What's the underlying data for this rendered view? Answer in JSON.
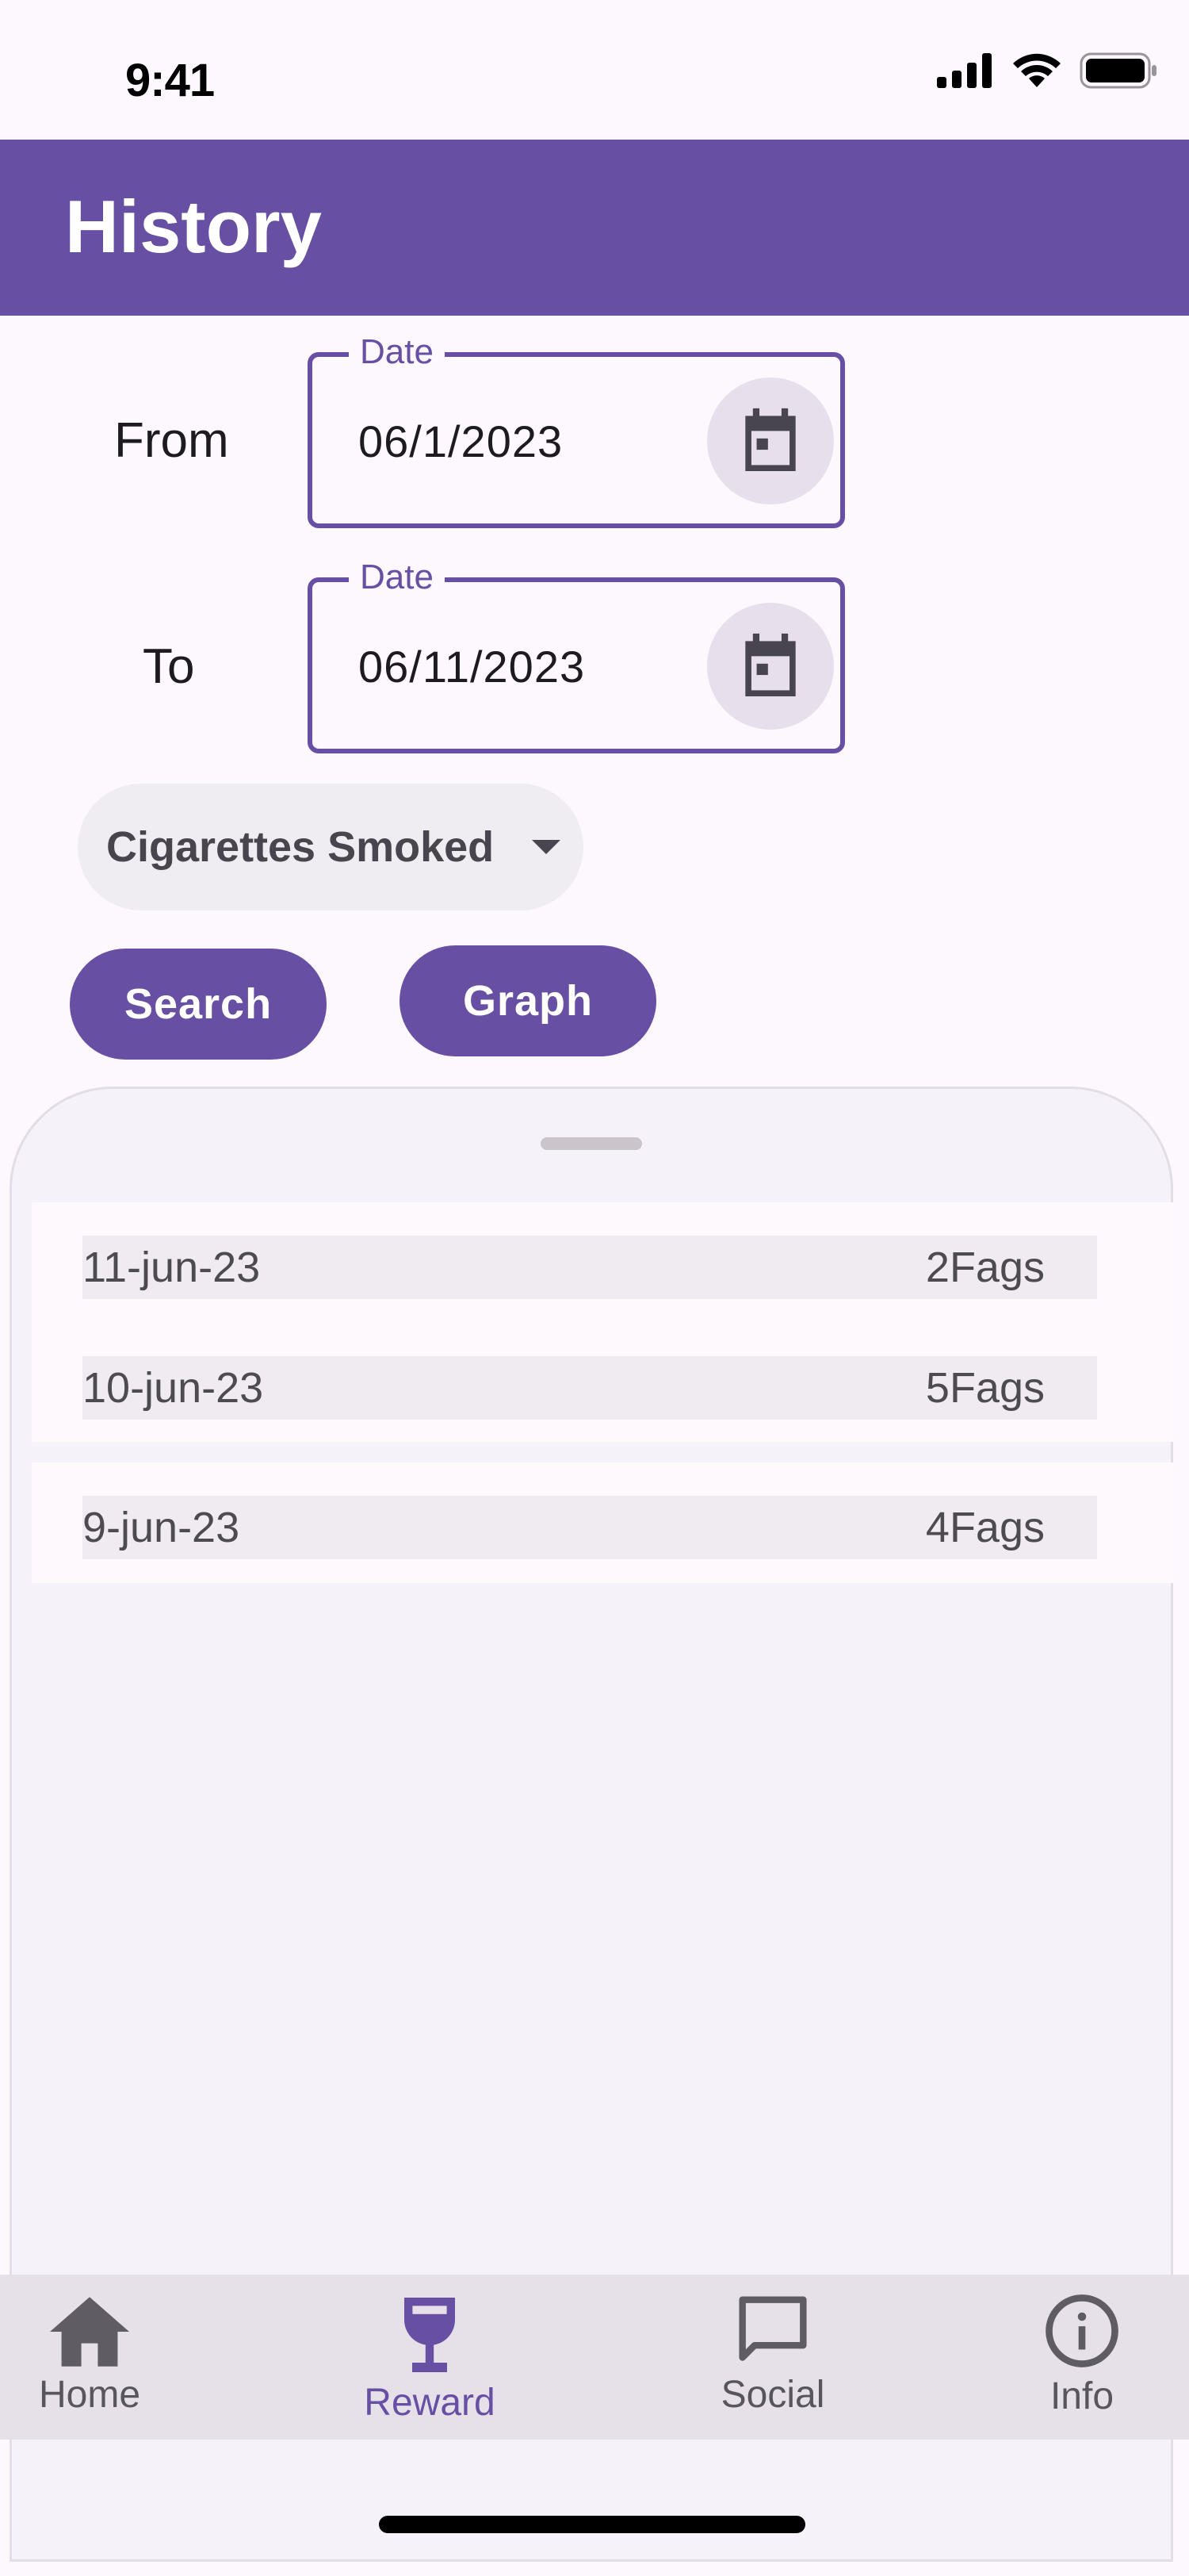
{
  "status_bar": {
    "time": "9:41",
    "icons": [
      "signal-icon",
      "wifi-icon",
      "battery-icon"
    ]
  },
  "app_bar": {
    "title": "History",
    "background_color": "#6750a4"
  },
  "filters": {
    "from": {
      "label": "From",
      "field_label": "Date",
      "value": "06/1/2023",
      "icon": "calendar-icon"
    },
    "to": {
      "label": "To",
      "field_label": "Date",
      "value": "06/11/2023",
      "icon": "calendar-icon"
    },
    "metric_select": {
      "selected": "Cigarettes Smoked",
      "icon": "caret-down-icon"
    },
    "search_button": "Search",
    "graph_button": "Graph"
  },
  "history": {
    "entries": [
      {
        "date": "11-jun-23",
        "value": "2Fags"
      },
      {
        "date": "10-jun-23",
        "value": "5Fags"
      },
      {
        "date": "9-jun-23",
        "value": "4Fags"
      }
    ]
  },
  "bottom_nav": {
    "items": [
      {
        "label": "Home",
        "icon": "home-icon",
        "active": false
      },
      {
        "label": "Reward",
        "icon": "goblet-icon",
        "active": true
      },
      {
        "label": "Social",
        "icon": "chat-bubble-icon",
        "active": false
      },
      {
        "label": "Info",
        "icon": "info-icon",
        "active": false
      }
    ]
  },
  "colors": {
    "primary": "#6750a4",
    "surface": "#fdf7fe",
    "sheet": "#f6f2f9",
    "nav": "#e6e1e9"
  }
}
